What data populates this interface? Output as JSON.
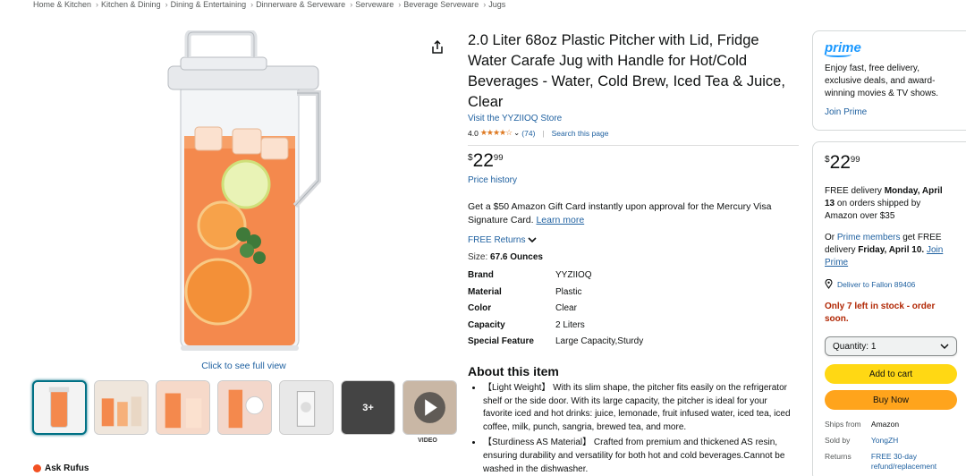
{
  "breadcrumb": [
    "Home & Kitchen",
    "Kitchen & Dining",
    "Dining & Entertaining",
    "Dinnerware & Serveware",
    "Serveware",
    "Beverage Serveware",
    "Jugs"
  ],
  "breadcrumb_sep": "›",
  "gallery": {
    "see_full": "Click to see full view",
    "more_label": "3+",
    "video_label": "VIDEO"
  },
  "rufus_label": "Ask Rufus",
  "product": {
    "title": "2.0 Liter 68oz Plastic Pitcher with Lid, Fridge Water Carafe Jug with Handle for Hot/Cold Beverages - Water, Cold Brew, Iced Tea & Juice, Clear",
    "store": "Visit the YYZIIOQ Store",
    "rating_value": "4.0",
    "rating_stars": 4,
    "rating_count": "(74)",
    "search_page": "Search this page",
    "price_currency": "$",
    "price_dollars": "22",
    "price_cents": "99",
    "price_history": "Price history",
    "gift_text": "Get a $50 Amazon Gift Card instantly upon approval for the Mercury Visa Signature Card.",
    "gift_link": "Learn more",
    "free_returns": "FREE Returns",
    "size_label": "Size:",
    "size_value": "67.6 Ounces",
    "specs": [
      {
        "k": "Brand",
        "v": "YYZIIOQ"
      },
      {
        "k": "Material",
        "v": "Plastic"
      },
      {
        "k": "Color",
        "v": "Clear"
      },
      {
        "k": "Capacity",
        "v": "2 Liters"
      },
      {
        "k": "Special Feature",
        "v": "Large Capacity,Sturdy"
      }
    ],
    "about_title": "About this item",
    "bullets": [
      "【Light Weight】 With its slim shape, the pitcher fits easily on the refrigerator shelf or the side door. With its large capacity, the pitcher is ideal for your favorite iced and hot drinks: juice, lemonade, fruit infused water, iced tea, iced coffee, milk, punch, sangria, brewed tea, and more.",
      "【Sturdiness AS Material】 Crafted from premium and thickened AS resin, ensuring durability and versatility for both hot and cold beverages.Cannot be washed in the dishwasher."
    ]
  },
  "prime": {
    "logo": "prime",
    "text": "Enjoy fast, free delivery, exclusive deals, and award-winning movies & TV shows.",
    "join": "Join Prime"
  },
  "buybox": {
    "currency": "$",
    "dollars": "22",
    "cents": "99",
    "delivery_pre": "FREE delivery",
    "delivery_date": "Monday, April 13",
    "delivery_post": "on orders shipped by Amazon over $35",
    "or": "Or",
    "prime_members": "Prime members",
    "get_free": "get FREE delivery",
    "prime_date": "Friday, April 10.",
    "join_prime": "Join Prime",
    "deliver_to": "Deliver to Fallon 89406",
    "stock": "Only 7 left in stock - order soon.",
    "qty_label": "Quantity:",
    "qty_value": "1",
    "add_cart": "Add to cart",
    "buy_now": "Buy Now",
    "info": [
      {
        "k": "Ships from",
        "v": "Amazon",
        "link": false
      },
      {
        "k": "Sold by",
        "v": "YongZH",
        "link": true
      },
      {
        "k": "Returns",
        "v": "FREE 30-day refund/replacement",
        "link": true
      }
    ]
  },
  "colors": {
    "link": "#2162a1",
    "star": "#de7921",
    "add_cart": "#ffd814",
    "buy_now": "#ffa41c",
    "stock": "#b12704",
    "prime": "#1a98ff"
  }
}
